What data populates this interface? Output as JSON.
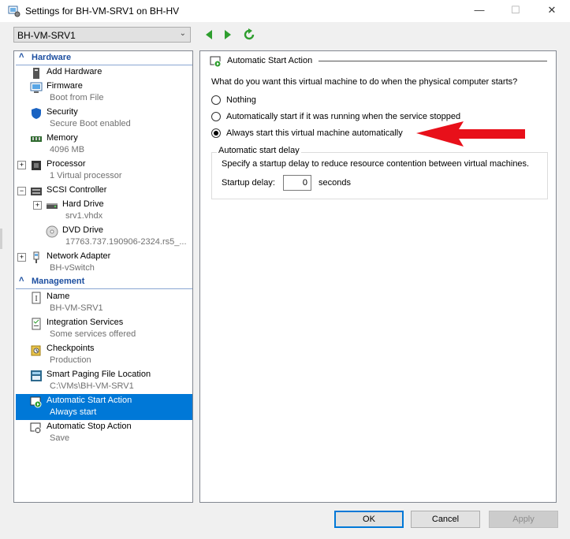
{
  "window": {
    "title": "Settings for BH-VM-SRV1 on BH-HV",
    "controls": {
      "minimize": "—",
      "maximize": "☐",
      "close": "✕"
    }
  },
  "toolbar": {
    "vm_selected": "BH-VM-SRV1",
    "icons": [
      "back-arrow-icon",
      "forward-arrow-icon",
      "refresh-icon"
    ],
    "colors": {
      "nav_green": "#2e9e2e"
    }
  },
  "sidebar": {
    "sections": {
      "hardware": "Hardware",
      "management": "Management"
    },
    "hardware_items": [
      {
        "label": "Add Hardware",
        "sub": ""
      },
      {
        "label": "Firmware",
        "sub": "Boot from File"
      },
      {
        "label": "Security",
        "sub": "Secure Boot enabled"
      },
      {
        "label": "Memory",
        "sub": "4096 MB"
      },
      {
        "label": "Processor",
        "sub": "1 Virtual processor"
      },
      {
        "label": "SCSI Controller",
        "sub": ""
      },
      {
        "label": "Hard Drive",
        "sub": "srv1.vhdx"
      },
      {
        "label": "DVD Drive",
        "sub": "17763.737.190906-2324.rs5_..."
      },
      {
        "label": "Network Adapter",
        "sub": "BH-vSwitch"
      }
    ],
    "management_items": [
      {
        "label": "Name",
        "sub": "BH-VM-SRV1"
      },
      {
        "label": "Integration Services",
        "sub": "Some services offered"
      },
      {
        "label": "Checkpoints",
        "sub": "Production"
      },
      {
        "label": "Smart Paging File Location",
        "sub": "C:\\VMs\\BH-VM-SRV1"
      },
      {
        "label": "Automatic Start Action",
        "sub": "Always start"
      },
      {
        "label": "Automatic Stop Action",
        "sub": "Save"
      }
    ],
    "selected_color": "#0078d7"
  },
  "main": {
    "title": "Automatic Start Action",
    "question": "What do you want this virtual machine to do when the physical computer starts?",
    "options": [
      {
        "label": "Nothing",
        "checked": false
      },
      {
        "label": "Automatically start if it was running when the service stopped",
        "checked": false
      },
      {
        "label": "Always start this virtual machine automatically",
        "checked": true
      }
    ],
    "delay_group": {
      "title": "Automatic start delay",
      "description": "Specify a startup delay to reduce resource contention between virtual machines.",
      "label": "Startup delay:",
      "value": "0",
      "unit": "seconds"
    },
    "arrow_color": "#e8101a"
  },
  "buttons": {
    "ok": "OK",
    "cancel": "Cancel",
    "apply": "Apply"
  }
}
